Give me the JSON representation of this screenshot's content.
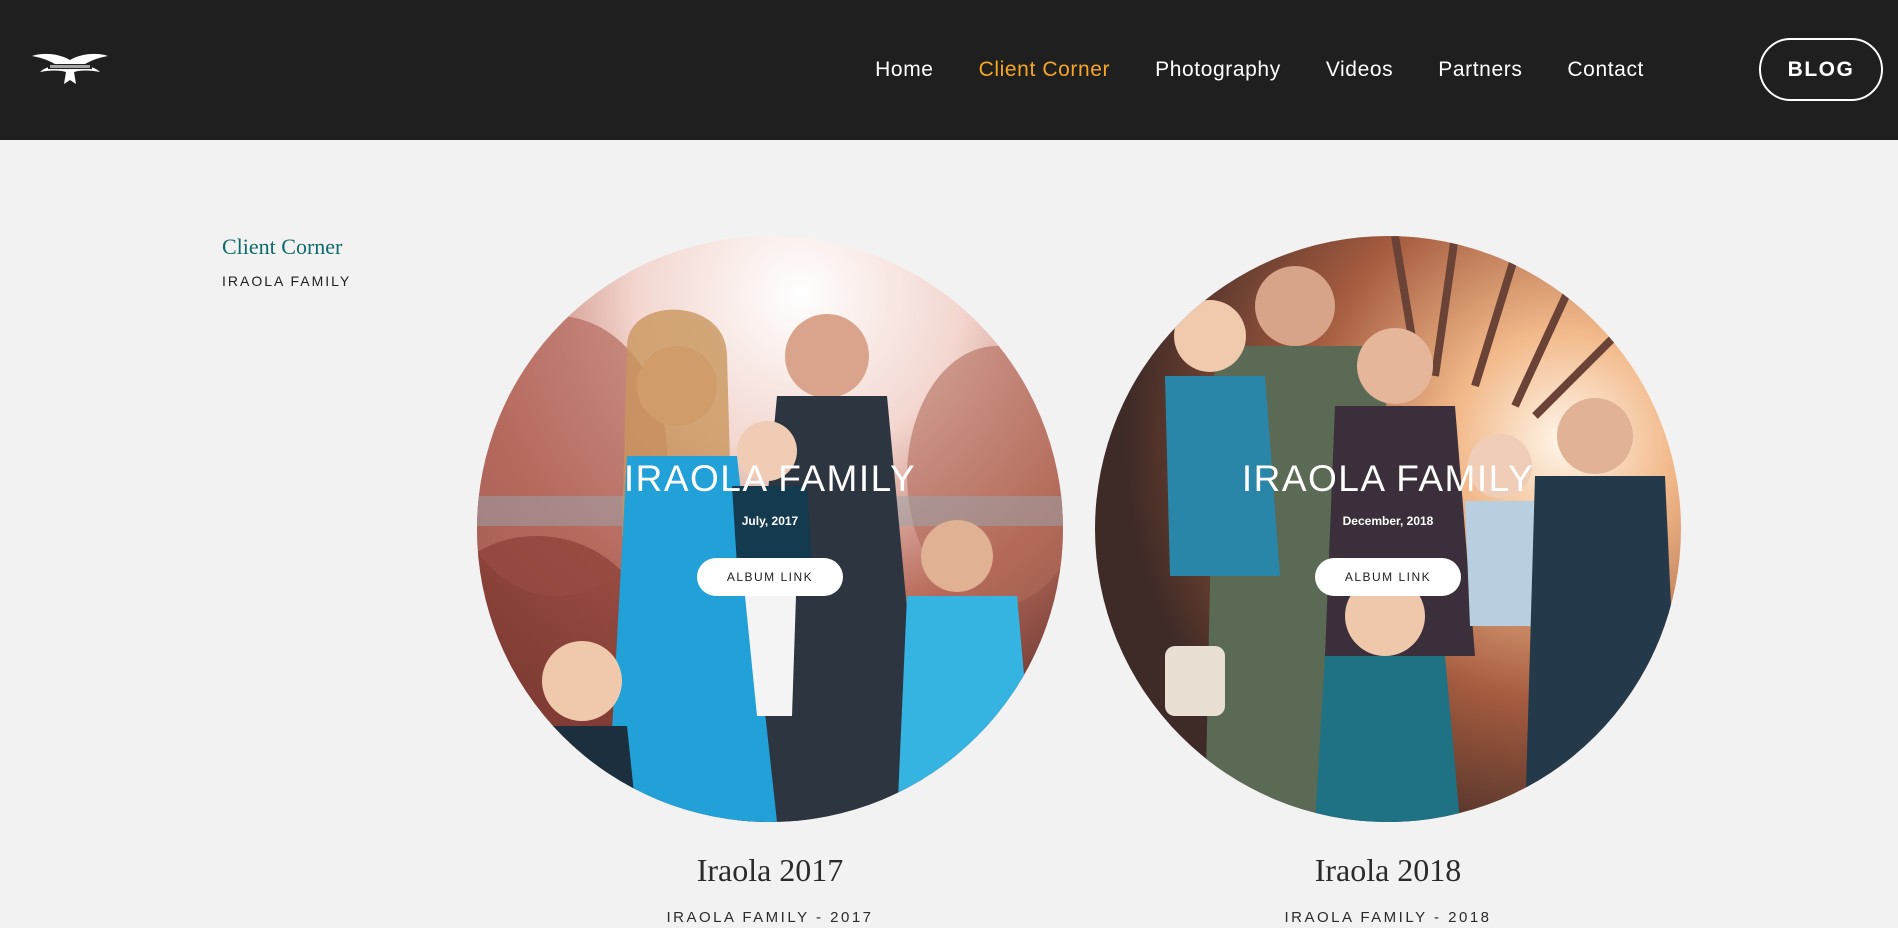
{
  "header": {
    "logo_icon": "eagle-logo-icon",
    "nav": [
      {
        "label": "Home",
        "active": false
      },
      {
        "label": "Client Corner",
        "active": true
      },
      {
        "label": "Photography",
        "active": false
      },
      {
        "label": "Videos",
        "active": false
      },
      {
        "label": "Partners",
        "active": false
      },
      {
        "label": "Contact",
        "active": false
      }
    ],
    "blog_label": "BLOG",
    "accent_color": "#f6a623",
    "background": "#1f1f1f"
  },
  "sidebar": {
    "heading": "Client Corner",
    "subheading": "IRAOLA FAMILY",
    "heading_color": "#0f6a6a"
  },
  "albums": [
    {
      "overlay_title": "IRAOLA FAMILY",
      "overlay_date": "July, 2017",
      "link_label": "ALBUM LINK",
      "name": "Iraola 2017",
      "caption": "IRAOLA FAMILY - 2017"
    },
    {
      "overlay_title": "IRAOLA FAMILY",
      "overlay_date": "December, 2018",
      "link_label": "ALBUM LINK",
      "name": "Iraola 2018",
      "caption": "IRAOLA FAMILY - 2018"
    }
  ]
}
